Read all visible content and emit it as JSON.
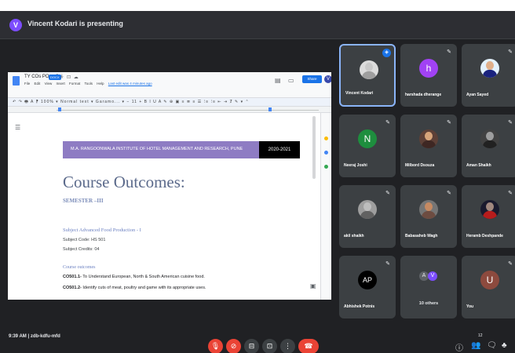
{
  "meeting": {
    "presenter_initial": "V",
    "presenter_text": "Vincent Kodari is presenting",
    "time": "9:39 AM",
    "separator": "|",
    "meeting_code": "zdb-kdfu-mfd"
  },
  "doc": {
    "name": "TY COs POs - Sei",
    "badge": "DOCX",
    "title_icons": "☆ ⊡ ☁",
    "menu": [
      "File",
      "Edit",
      "View",
      "Insert",
      "Format",
      "Tools",
      "Help"
    ],
    "last_edit": "Last edit was 4 minutes ago",
    "share_label": "Share",
    "user_initial": "V",
    "toolbar_text": "↶ ↷ 🖶 A ⁋ 100% ▾ Normal text ▾ Garamo... ▾ − 11 + B I U A ✎ ⊕ ▣ ≡ ≣ ≡ ☰ ⁝≡ ⁝≡ ⇤ ⇥ Ⱦ ✎ ▾ ⌃",
    "institute": "M.A. RANGOONWALA INSTITUTE OF HOTEL MANAGEMENT AND RESEARCH, PUNE",
    "year": "2020-2021",
    "heading": "Course Outcomes:",
    "semester": "SEMESTER –III",
    "subject_title": "Subject Advanced Food Production - I",
    "subject_code": "Subject Code: HS 501",
    "subject_credits": "Subject Credits: 04",
    "course_outcomes_label": "Course outcomes",
    "outcomes": [
      {
        "code": "CO501.1-",
        "text": " To Understand European, North & South American cuisine food."
      },
      {
        "code": "CO501.2-",
        "text": " Identify cuts of meat, poultry and game with its appropriate uses."
      }
    ]
  },
  "participants": [
    {
      "name": "Vincent Kodari",
      "kind": "photo",
      "skin": "#c9c9c9",
      "shirt": "#9e9e9e",
      "bg": "#dcdcdc",
      "mic": "blue"
    },
    {
      "name": "harshada dherange",
      "kind": "avatar",
      "initial": "h",
      "color": "#a142f4",
      "mic": "muted"
    },
    {
      "name": "Ayan Sayed",
      "kind": "photo",
      "skin": "#e0b08a",
      "shirt": "#1a237e",
      "bg": "#e3f2fd",
      "mic": "muted"
    },
    {
      "name": "Neeraj Joshi",
      "kind": "avatar",
      "initial": "N",
      "color": "#1e8e3e",
      "mic": "muted"
    },
    {
      "name": "Milbord Dsouza",
      "kind": "photo",
      "skin": "#d7a47a",
      "shirt": "#3e2723",
      "bg": "#5d4037",
      "mic": "muted"
    },
    {
      "name": "Aman Shaikh",
      "kind": "photo",
      "skin": "#9e9e9e",
      "shirt": "#212121",
      "bg": "#424242",
      "mic": "muted"
    },
    {
      "name": "akil shaikh",
      "kind": "photo",
      "skin": "#bdbdbd",
      "shirt": "#616161",
      "bg": "#9e9e9e",
      "mic": "muted"
    },
    {
      "name": "Babasaheb Wagh",
      "kind": "photo",
      "skin": "#c68a62",
      "shirt": "#6d4c41",
      "bg": "#757575",
      "mic": "muted"
    },
    {
      "name": "Heramb Deshpande",
      "kind": "photo",
      "skin": "#a1887f",
      "shirt": "#b71c1c",
      "bg": "#1a1a2e",
      "mic": "muted"
    },
    {
      "name": "Abhishek Potnis",
      "kind": "avatar",
      "initial": "AP",
      "color": "#000000",
      "mic": "muted"
    },
    {
      "name": "10 others",
      "kind": "others",
      "initials": [
        "A",
        "V"
      ],
      "mic": "none"
    },
    {
      "name": "You",
      "kind": "avatar",
      "initial": "U",
      "color": "#8d4a3e",
      "mic": "muted"
    }
  ],
  "icons": {
    "mic_muted": "✎",
    "mic_active": "◈",
    "mic_off_button": "🎙",
    "camera_off_button": "⊘",
    "captions_button": "⊟",
    "present_button": "⊡",
    "more_button": "⋮",
    "end_call_button": "☎",
    "info": "ⓘ",
    "people": "👥",
    "chat": "🗨",
    "activities": "♣",
    "people_count": "12"
  }
}
